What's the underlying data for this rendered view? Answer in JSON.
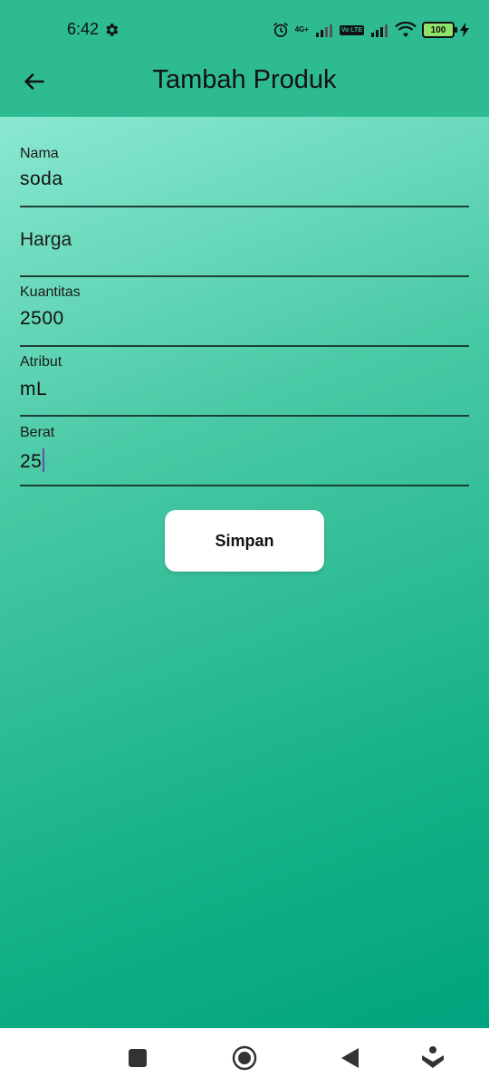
{
  "status": {
    "time": "6:42",
    "network_label": "4G+",
    "volte": "Vo LTE",
    "battery": "100"
  },
  "appbar": {
    "title": "Tambah Produk"
  },
  "form": {
    "nama": {
      "label": "Nama",
      "value": "soda"
    },
    "harga": {
      "label": "Harga",
      "value": ""
    },
    "kuantitas": {
      "label": "Kuantitas",
      "value": "2500"
    },
    "atribut": {
      "label": "Atribut",
      "value": "mL"
    },
    "berat": {
      "label": "Berat",
      "value": "25"
    }
  },
  "save_button": {
    "label": "Simpan"
  },
  "icons": {
    "back": "arrow-back-icon",
    "settings": "gear-icon",
    "alarm": "alarm-icon",
    "wifi": "wifi-icon",
    "nav_recent": "square-icon",
    "nav_home": "circle-icon",
    "nav_back": "triangle-back-icon",
    "nav_assist": "assist-icon"
  },
  "colors": {
    "appbar": "#2ebb92",
    "gradient_top": "#8ae8d1",
    "gradient_bottom": "#00a47e"
  }
}
